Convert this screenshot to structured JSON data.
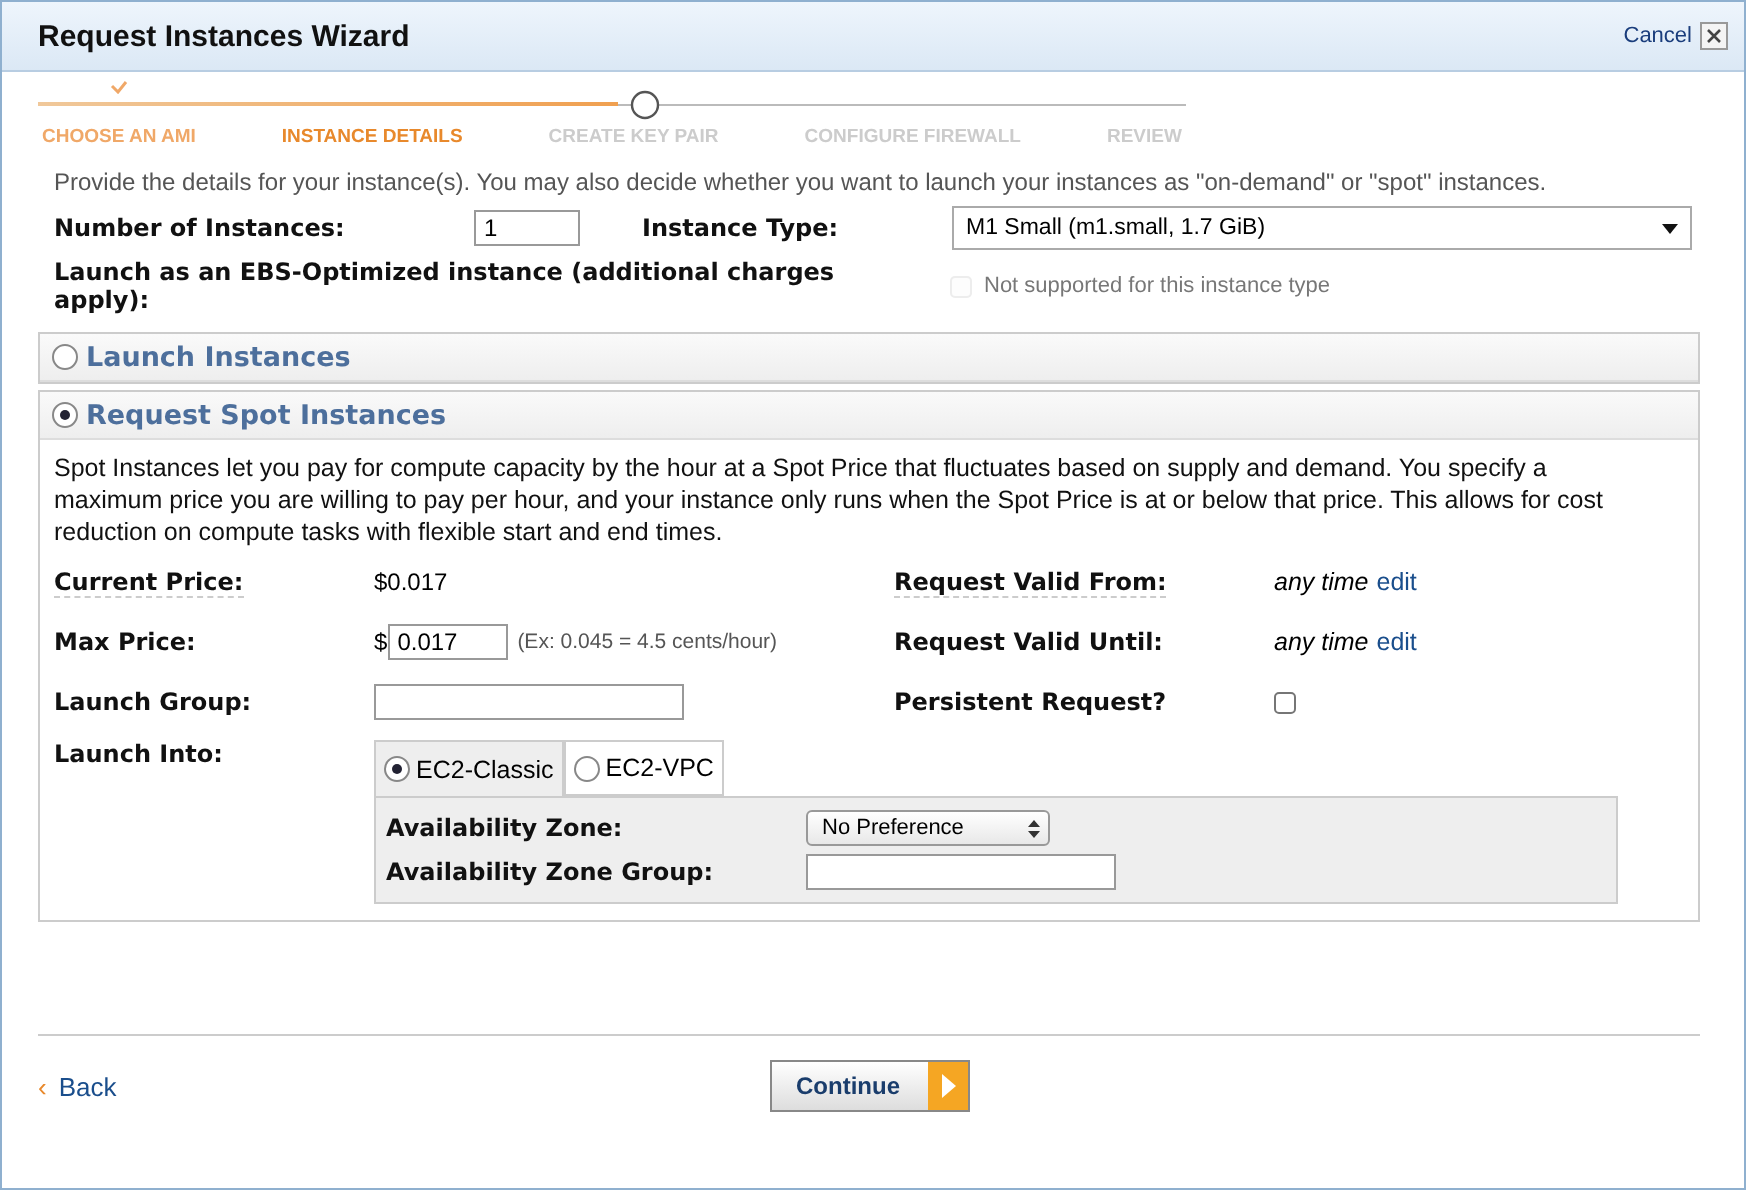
{
  "window": {
    "title": "Request Instances Wizard",
    "cancel": "Cancel"
  },
  "steps": [
    {
      "label": "CHOOSE AN AMI",
      "completed": true,
      "selected": false
    },
    {
      "label": "INSTANCE DETAILS",
      "completed": false,
      "selected": true
    },
    {
      "label": "CREATE KEY PAIR",
      "completed": false,
      "selected": false
    },
    {
      "label": "CONFIGURE FIREWALL",
      "completed": false,
      "selected": false
    },
    {
      "label": "REVIEW",
      "completed": false,
      "selected": false
    }
  ],
  "intro": "Provide the details for your instance(s). You may also decide whether you want to launch your instances as \"on-demand\" or \"spot\" instances.",
  "number_of_instances": {
    "label": "Number of Instances:",
    "value": "1"
  },
  "instance_type": {
    "label": "Instance Type:",
    "value": "M1 Small (m1.small, 1.7 GiB)"
  },
  "ebs_optimized": {
    "label": "Launch as an EBS-Optimized instance (additional charges apply):",
    "note": "Not supported for this instance type",
    "checked": false,
    "disabled": true
  },
  "sections": [
    {
      "title": "Launch Instances",
      "selected": false
    },
    {
      "title": "Request Spot Instances",
      "selected": true
    }
  ],
  "spot": {
    "description": "Spot Instances let you pay for compute capacity by the hour at a Spot Price that fluctuates based on supply and demand. You specify a maximum price you are willing to pay per hour, and your instance only runs when the Spot Price is at or below that price. This allows for cost reduction on compute tasks with flexible start and end times.",
    "current_price": {
      "label": "Current Price:",
      "value": "$0.017"
    },
    "max_price": {
      "label": "Max Price:",
      "currency": "$",
      "value": "0.017",
      "hint": "(Ex: 0.045 = 4.5 cents/hour)"
    },
    "launch_group": {
      "label": "Launch Group:"
    },
    "valid_from": {
      "label": "Request Valid From:",
      "value": "any time",
      "link": "edit"
    },
    "valid_until": {
      "label": "Request Valid Until:",
      "value": "any time",
      "link": "edit"
    },
    "persistent": {
      "label": "Persistent Request?",
      "checked": false
    },
    "launch_into": {
      "label": "Launch Into:",
      "tabs": [
        {
          "label": "EC2-Classic",
          "selected": true
        },
        {
          "label": "EC2-VPC",
          "selected": false
        }
      ],
      "availability_zone": {
        "label": "Availability Zone:",
        "value": "No Preference"
      },
      "zone_group": {
        "label": "Availability Zone Group:"
      }
    }
  },
  "footer": {
    "back": "Back",
    "back_arrow": "‹",
    "continue": "Continue"
  }
}
